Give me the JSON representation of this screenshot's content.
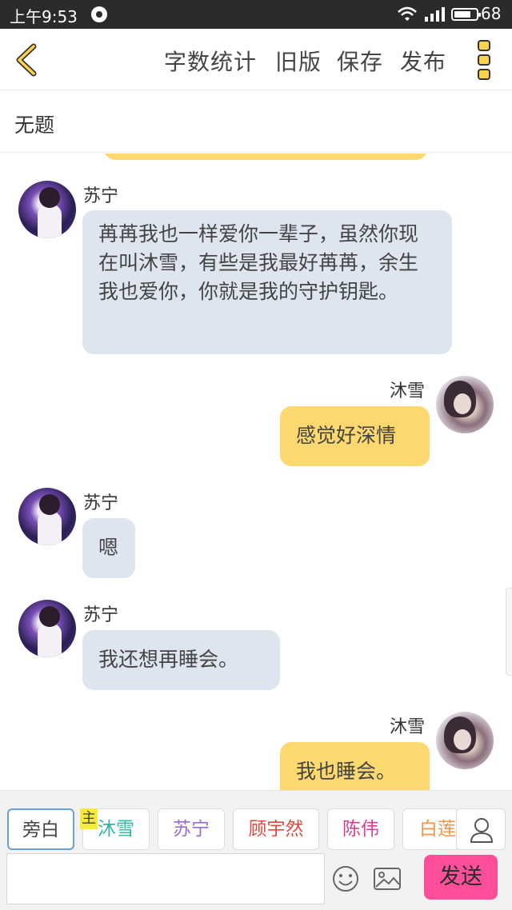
{
  "status_bar": {
    "time": "上午9:53",
    "battery": "68"
  },
  "toolbar": {
    "actions": [
      "字数统计",
      "旧版",
      "保存",
      "发布"
    ]
  },
  "title": "无题",
  "messages": [
    {
      "sender": "苏宁",
      "side": "left",
      "text": "苒苒我也一样爱你一辈子，虽然你现在叫沐雪，有些是我最好苒苒，余生我也爱你，你就是我的守护钥匙。"
    },
    {
      "sender": "沐雪",
      "side": "right",
      "text": "感觉好深情"
    },
    {
      "sender": "苏宁",
      "side": "left",
      "text": "嗯"
    },
    {
      "sender": "苏宁",
      "side": "left",
      "text": "我还想再睡会。"
    },
    {
      "sender": "沐雪",
      "side": "right",
      "text": "我也睡会。"
    }
  ],
  "roles": [
    {
      "label": "旁白",
      "color": "#444444"
    },
    {
      "label": "沐雪",
      "color": "#2fb5a8"
    },
    {
      "label": "苏宁",
      "color": "#9b6ad1"
    },
    {
      "label": "顾宇然",
      "color": "#e0493c"
    },
    {
      "label": "陈伟",
      "color": "#d8408f"
    },
    {
      "label": "白莲",
      "color": "#f0954a"
    }
  ],
  "host_tag": "主",
  "input": {
    "placeholder": ""
  },
  "send_label": "发送"
}
